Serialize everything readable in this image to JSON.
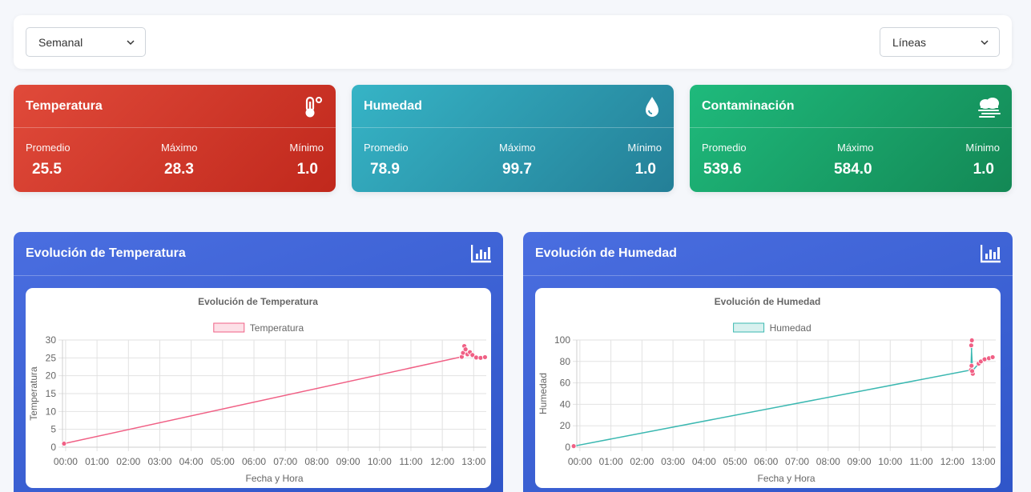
{
  "filters": {
    "period": {
      "selected": "Semanal"
    },
    "chart_type": {
      "selected": "Líneas"
    }
  },
  "cards": {
    "temperature": {
      "title": "Temperatura",
      "labels": {
        "avg": "Promedio",
        "max": "Máximo",
        "min": "Mínimo"
      },
      "avg": "25.5",
      "max": "28.3",
      "min": "1.0",
      "icon": "thermometer-icon"
    },
    "humidity": {
      "title": "Humedad",
      "labels": {
        "avg": "Promedio",
        "max": "Máximo",
        "min": "Mínimo"
      },
      "avg": "78.9",
      "max": "99.7",
      "min": "1.0",
      "icon": "droplet-icon"
    },
    "pollution": {
      "title": "Contaminación",
      "labels": {
        "avg": "Promedio",
        "max": "Máximo",
        "min": "Mínimo"
      },
      "avg": "539.6",
      "max": "584.0",
      "min": "1.0",
      "icon": "smog-icon"
    }
  },
  "colors": {
    "temp_series": "#f06085",
    "hum_series": "#3bb8b1"
  },
  "chart_data": [
    {
      "type": "line",
      "card_title": "Evolución de Temperatura",
      "title": "Evolución de Temperatura",
      "xlabel": "Fecha y Hora",
      "ylabel": "Temperatura",
      "ylim": [
        0,
        30
      ],
      "yticks": [
        0,
        5,
        10,
        15,
        20,
        25,
        30
      ],
      "xlim": [
        -0.1,
        13.4
      ],
      "xticks": [
        "00:00",
        "01:00",
        "02:00",
        "03:00",
        "04:00",
        "05:00",
        "06:00",
        "07:00",
        "08:00",
        "09:00",
        "10:00",
        "11:00",
        "12:00",
        "13:00"
      ],
      "grid": true,
      "legend": "top",
      "series": [
        {
          "name": "Temperatura",
          "x": [
            -0.05,
            12.62,
            12.66,
            12.7,
            12.74,
            12.8,
            12.88,
            12.96,
            13.08,
            13.22,
            13.36
          ],
          "y": [
            1.0,
            25.3,
            26.4,
            28.3,
            27.4,
            26.0,
            26.6,
            25.8,
            25.1,
            25.0,
            25.2
          ]
        }
      ]
    },
    {
      "type": "line",
      "card_title": "Evolución de Humedad",
      "title": "Evolución de Humedad",
      "xlabel": "Fecha y Hora",
      "ylabel": "Humedad",
      "ylim": [
        0,
        100
      ],
      "yticks": [
        0,
        20,
        40,
        60,
        80,
        100
      ],
      "xlim": [
        -0.1,
        13.4
      ],
      "xticks": [
        "00:00",
        "01:00",
        "02:00",
        "03:00",
        "04:00",
        "05:00",
        "06:00",
        "07:00",
        "08:00",
        "09:00",
        "10:00",
        "11:00",
        "12:00",
        "13:00"
      ],
      "grid": true,
      "legend": "top",
      "series": [
        {
          "name": "Humedad",
          "x": [
            -0.2,
            12.6,
            12.63,
            12.61,
            12.66,
            12.62,
            12.64,
            12.85,
            12.92,
            13.04,
            13.18,
            13.3
          ],
          "y": [
            1.0,
            72.0,
            99.7,
            95.0,
            68.5,
            76.0,
            71.0,
            78.0,
            80.0,
            82.0,
            83.0,
            84.0
          ]
        }
      ]
    }
  ]
}
